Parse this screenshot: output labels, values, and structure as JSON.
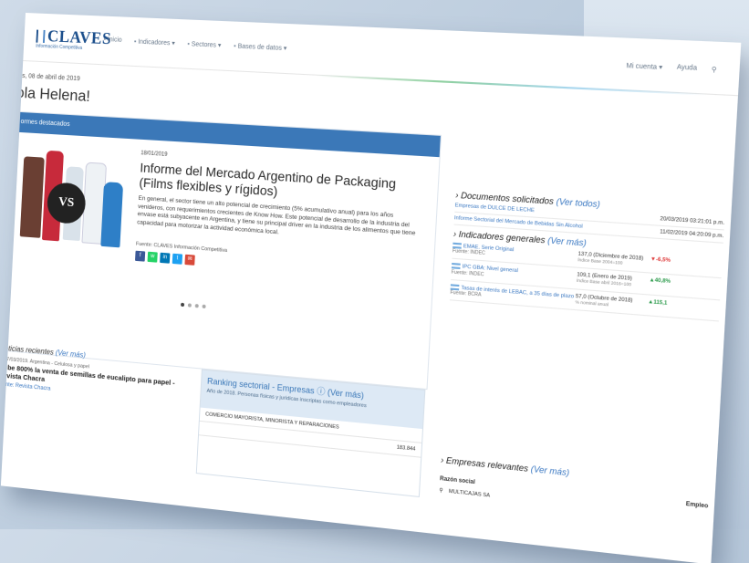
{
  "app": {
    "logo_text": "CLAVES",
    "logo_subtitle": "Información Competitiva",
    "nav": [
      "Inicio",
      "Indicadores ▾",
      "Sectores ▾",
      "Bases de datos ▾"
    ],
    "right_nav": [
      "Mi cuenta ▾",
      "Ayuda"
    ]
  },
  "greeting": {
    "date": "es, 08 de abril de 2019",
    "text": "ola Helena!"
  },
  "featured": {
    "header": "ormes destacados",
    "image_text": "VS",
    "date": "18/01/2019",
    "title": "Informe del Mercado Argentino de Packaging (Films flexibles y rígidos)",
    "body": "En general, el sector tiene un alto potencial de crecimiento (5% acumulativo anual) para los años venideros, con requerimientos crecientes de Know How. Este potencial de desarrollo de la industria del envase está subyacente en Argentina, y tiene su principal driver en la industria de los alimentos que tiene capacidad para motorizar la actividad económica local.",
    "source": "Fuente: CLAVES Información Competitiva",
    "share_icons": [
      "f",
      "w",
      "in",
      "t",
      "✉"
    ],
    "next": "›"
  },
  "news": {
    "title": "oticias recientes",
    "more": "(Ver más)",
    "meta": "27/03/2019. Argentina - Celulosa y papel",
    "headline": "ube 800% la venta de semillas de eucalipto para papel - evista Chacra",
    "link": "ente: Revista Chacra"
  },
  "ranking": {
    "title": "Ranking sectorial - Empresas",
    "more": "(Ver más)",
    "subtitle": "Año de 2018. Personas físicas y jurídicas inscriptas como empleadores",
    "rows": [
      {
        "label": "COMERCIO MAYORISTA, MINORISTA Y REPARACIONES",
        "value": ""
      },
      {
        "label": "",
        "value": "183.844"
      }
    ]
  },
  "documents": {
    "title": "Documentos solicitados",
    "more": "(Ver todos)",
    "rows": [
      {
        "name": "Empresas de DULCE DE LECHE",
        "date": "20/03/2019 03:21:01 p.m."
      },
      {
        "name": "Informe Sectorial del Mercado de Bebidas Sin Alcohol",
        "date": "11/02/2019 04:20:09 p.m."
      }
    ]
  },
  "indicators": {
    "title": "Indicadores generales",
    "more": "(Ver más)",
    "rows": [
      {
        "name": "EMAE. Serie Original",
        "source": "Fuente: INDEC",
        "value": "137,0 (Diciembre de 2018)",
        "note": "Índice Base 2004=100",
        "change": "-6,5%",
        "dir": "down"
      },
      {
        "name": "IPC GBA: Nivel general",
        "source": "Fuente: INDEC",
        "value": "109,1 (Enero de 2019)",
        "note": "Índice Base abril 2016=100",
        "change": "40,8%",
        "dir": "up"
      },
      {
        "name": "Tasas de interés de LEBAC, a 35 días de plazo",
        "source": "Fuente: BCRA",
        "value": "57,0 (Octubre de 2018)",
        "note": "% nominal anual",
        "change": "115,1",
        "dir": "up"
      }
    ]
  },
  "companies": {
    "title": "Empresas relevantes",
    "more": "(Ver más)",
    "col_name": "Razón social",
    "col_emp": "Empleo",
    "rows": [
      {
        "name": "MULTICAJAS SA"
      }
    ]
  },
  "colors": {
    "brand": "#1c4f8c",
    "accent": "#3b78b8",
    "down": "#dd3333",
    "up": "#2a9a4a"
  }
}
